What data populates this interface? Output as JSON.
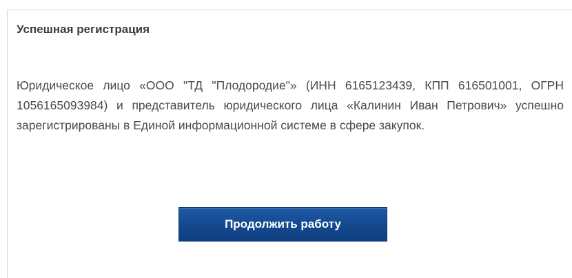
{
  "panel": {
    "title": "Успешная регистрация",
    "message": "Юридическое лицо «ООО \"ТД \"Плодородие\"» (ИНН 6165123439, КПП 616501001, ОГРН 1056165093984) и представитель юридического лица «Калинин Иван Петрович» успешно зарегистрированы в Единой информационной системе в сфере закупок.",
    "continue_label": "Продолжить работу"
  },
  "colors": {
    "button_background": "#13488e",
    "button_text": "#ffffff",
    "panel_border": "#c8d6e3",
    "title_text": "#3b3b3b",
    "body_text": "#4a4a4a"
  }
}
